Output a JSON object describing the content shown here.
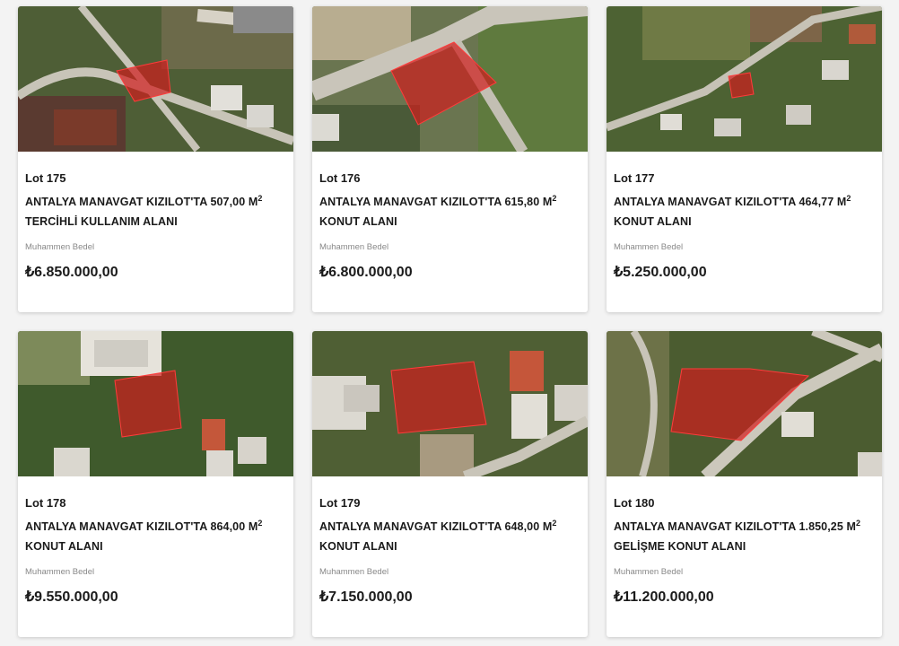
{
  "listings": [
    {
      "lot": "Lot 175",
      "title_line1": "ANTALYA MANAVGAT KIZILOT'TA 507,00 M",
      "title_sup": "2",
      "title_line2": "TERCİHLİ KULLANIM ALANI",
      "bedel_label": "Muhammen Bedel",
      "price": "₺6.850.000,00"
    },
    {
      "lot": "Lot 176",
      "title_line1": "ANTALYA MANAVGAT KIZILOT'TA 615,80 M",
      "title_sup": "2",
      "title_line2": "KONUT ALANI",
      "bedel_label": "Muhammen Bedel",
      "price": "₺6.800.000,00"
    },
    {
      "lot": "Lot 177",
      "title_line1": "ANTALYA MANAVGAT KIZILOT'TA 464,77 M",
      "title_sup": "2",
      "title_line2": "KONUT ALANI",
      "bedel_label": "Muhammen Bedel",
      "price": "₺5.250.000,00"
    },
    {
      "lot": "Lot 178",
      "title_line1": "ANTALYA MANAVGAT KIZILOT'TA 864,00 M",
      "title_sup": "2",
      "title_line2": "KONUT ALANI",
      "bedel_label": "Muhammen Bedel",
      "price": "₺9.550.000,00"
    },
    {
      "lot": "Lot 179",
      "title_line1": "ANTALYA MANAVGAT KIZILOT'TA 648,00 M",
      "title_sup": "2",
      "title_line2": "KONUT ALANI",
      "bedel_label": "Muhammen Bedel",
      "price": "₺7.150.000,00"
    },
    {
      "lot": "Lot 180",
      "title_line1": "ANTALYA MANAVGAT KIZILOT'TA 1.850,25 M",
      "title_sup": "2",
      "title_line2": "GELİŞME KONUT ALANI",
      "bedel_label": "Muhammen Bedel",
      "price": "₺11.200.000,00"
    }
  ],
  "colors": {
    "parcel_fill": "#d01c1c",
    "card_background": "#ffffff",
    "page_background": "#f3f3f3"
  },
  "icons": [
    "satellite-map-thumbnail",
    "parcel-overlay"
  ]
}
